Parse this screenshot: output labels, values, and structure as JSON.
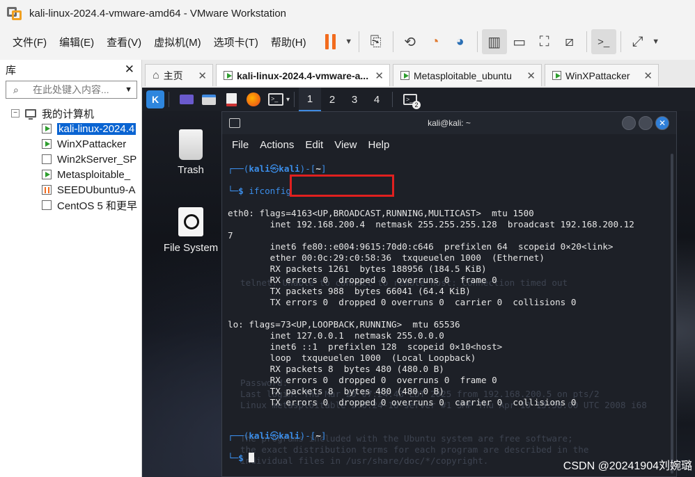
{
  "window": {
    "title": "kali-linux-2024.4-vmware-amd64 - VMware Workstation"
  },
  "menu": [
    "文件(F)",
    "编辑(E)",
    "查看(V)",
    "虚拟机(M)",
    "选项卡(T)",
    "帮助(H)"
  ],
  "library": {
    "title": "库",
    "close": "✕",
    "search_placeholder": "在此处键入内容...",
    "root": "我的计算机",
    "items": [
      {
        "label": "kali-linux-2024.4",
        "state": "running",
        "selected": true
      },
      {
        "label": "WinXPattacker",
        "state": "running"
      },
      {
        "label": "Win2kServer_SP",
        "state": "off"
      },
      {
        "label": "Metasploitable_",
        "state": "running"
      },
      {
        "label": "SEEDUbuntu9-A",
        "state": "suspended"
      },
      {
        "label": "CentOS 5 和更早",
        "state": "off"
      }
    ]
  },
  "tabs": [
    {
      "label": "主页",
      "icon": "home-icon"
    },
    {
      "label": "kali-linux-2024.4-vmware-a...",
      "active": true
    },
    {
      "label": "Metasploitable_ubuntu"
    },
    {
      "label": "WinXPattacker"
    }
  ],
  "guest": {
    "workspaces": [
      "1",
      "2",
      "3",
      "4"
    ],
    "terminal_badge": "2",
    "desktop_icons": [
      "Trash",
      "File System"
    ],
    "terminal": {
      "title": "kali@kali: ~",
      "menu": [
        "File",
        "Actions",
        "Edit",
        "View",
        "Help"
      ],
      "prompt_user": "kali",
      "prompt_host": "kali",
      "prompt_dir": "~",
      "command": "ifconfig",
      "lines": [
        "eth0: flags=4163<UP,BROADCAST,RUNNING,MULTICAST>  mtu 1500",
        "        inet 192.168.200.4  netmask 255.255.255.128  broadcast 192.168.200.12",
        "7",
        "        inet6 fe80::e004:9615:70d0:c646  prefixlen 64  scopeid 0×20<link>",
        "        ether 00:0c:29:c0:58:36  txqueuelen 1000  (Ethernet)",
        "        RX packets 1261  bytes 188956 (184.5 KiB)",
        "        RX errors 0  dropped 0  overruns 0  frame 0",
        "        TX packets 988  bytes 66041 (64.4 KiB)",
        "        TX errors 0  dropped 0 overruns 0  carrier 0  collisions 0",
        "",
        "lo: flags=73<UP,LOOPBACK,RUNNING>  mtu 65536",
        "        inet 127.0.0.1  netmask 255.0.0.0",
        "        inet6 ::1  prefixlen 128  scopeid 0×10<host>",
        "        loop  txqueuelen 1000  (Local Loopback)",
        "        RX packets 8  bytes 480 (480.0 B)",
        "        RX errors 0  dropped 0  overruns 0  frame 0",
        "        TX packets 8  bytes 480 (480.0 B)",
        "        TX errors 0  dropped 0 overruns 0  carrier 0  collisions 0",
        ""
      ],
      "ghost_lines": [
        "telnet: Unable to connect to remote host: Connection timed out",
        "Password:",
        "Last login: Thu Mar 20 07:24:43 EDT 2025 from 192.168.200.5 on pts/2",
        "Linux metasploitable 2.6.24-16-server #1 SMP Thu Apr 10 13:58:00 UTC 2008 i68",
        "The programs included with the Ubuntu system are free software;",
        "the exact distribution terms for each program are described in the",
        "individual files in /usr/share/doc/*/copyright."
      ]
    }
  },
  "watermark": "CSDN @20241904刘婉璐",
  "colors": {
    "accent_orange": "#f26b1d",
    "selection_blue": "#0a64d2",
    "highlight_red": "#e0201f",
    "kali_blue": "#3b8eea"
  }
}
